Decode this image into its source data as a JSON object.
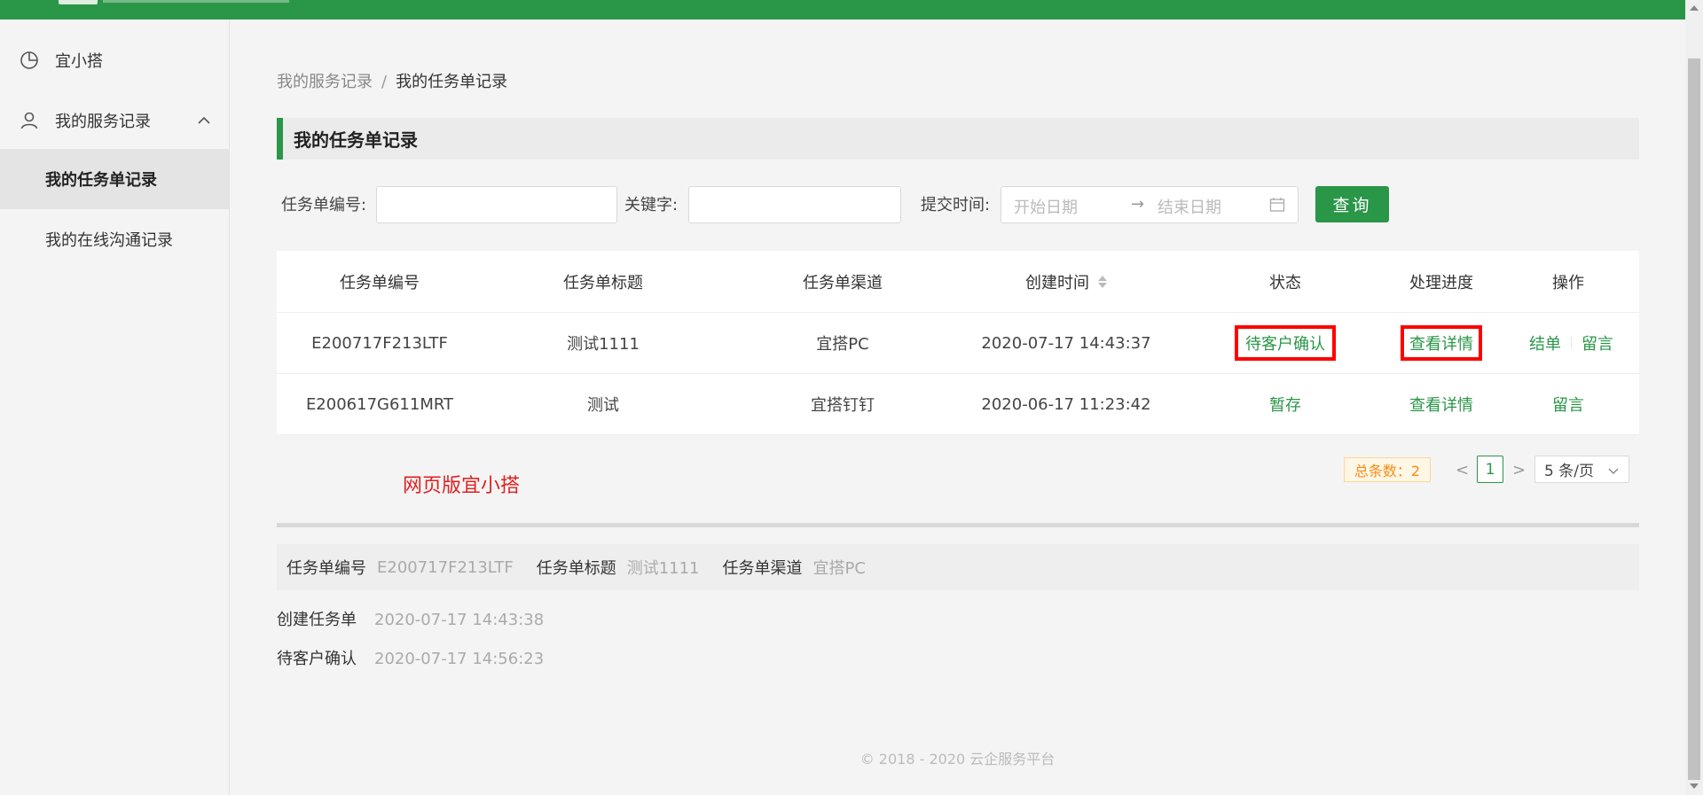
{
  "colors": {
    "brand": "#2a9648",
    "highlight_border": "#ff0000",
    "annotation_text": "#e02020",
    "badge_text": "#fa8c16"
  },
  "sidebar": {
    "items": [
      {
        "label": "宜小搭",
        "icon": "pie-chart-icon"
      },
      {
        "label": "我的服务记录",
        "icon": "user-icon",
        "expanded": true
      }
    ],
    "subitems": [
      {
        "label": "我的任务单记录",
        "active": true
      },
      {
        "label": "我的在线沟通记录",
        "active": false
      }
    ]
  },
  "breadcrumb": {
    "parent": "我的服务记录",
    "separator": "/",
    "current": "我的任务单记录"
  },
  "section": {
    "title": "我的任务单记录"
  },
  "filters": {
    "task_no_label": "任务单编号:",
    "keyword_label": "关键字:",
    "submit_time_label": "提交时间:",
    "start_placeholder": "开始日期",
    "end_placeholder": "结束日期",
    "range_arrow": "→",
    "query_button": "查询"
  },
  "table": {
    "headers": [
      "任务单编号",
      "任务单标题",
      "任务单渠道",
      "创建时间",
      "状态",
      "处理进度",
      "操作"
    ],
    "rows": [
      {
        "no": "E200717F213LTF",
        "title": "测试1111",
        "channel": "宜搭PC",
        "created": "2020-07-17 14:43:37",
        "status": "待客户确认",
        "progress": "查看详情",
        "actions": [
          "结单",
          "留言"
        ]
      },
      {
        "no": "E200617G611MRT",
        "title": "测试",
        "channel": "宜搭钉钉",
        "created": "2020-06-17 11:23:42",
        "status": "暂存",
        "progress": "查看详情",
        "actions": [
          "留言"
        ]
      }
    ]
  },
  "annotation": "网页版宜小搭",
  "pagination": {
    "total": "总条数：2",
    "prev": "<",
    "current": "1",
    "next": ">",
    "page_size": "5 条/页"
  },
  "detail": {
    "fields": [
      {
        "label": "任务单编号",
        "value": "E200717F213LTF"
      },
      {
        "label": "任务单标题",
        "value": "测试1111"
      },
      {
        "label": "任务单渠道",
        "value": "宜搭PC"
      }
    ],
    "log": [
      {
        "label": "创建任务单",
        "time": "2020-07-17 14:43:38"
      },
      {
        "label": "待客户确认",
        "time": "2020-07-17 14:56:23"
      }
    ]
  },
  "footer": "© 2018 - 2020 云企服务平台"
}
